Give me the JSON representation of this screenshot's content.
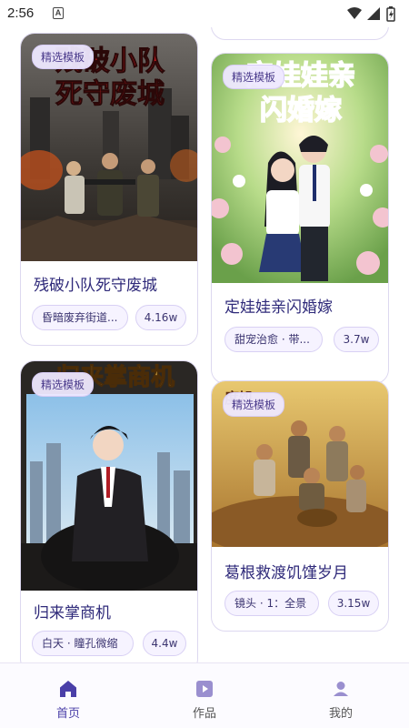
{
  "status_bar": {
    "time": "2:56",
    "notification_icon": "a-letter-icon",
    "icons": [
      "wifi-icon",
      "signal-icon",
      "battery-icon"
    ]
  },
  "colors": {
    "accent": "#4a3fa8",
    "badge_bg": "#eee8ff",
    "tag_bg": "#f6f3ff",
    "card_border": "#ddd8f0"
  },
  "feed": {
    "cards": [
      {
        "badge": "精选模板",
        "title": "残破小队死守废城",
        "cover_text": "残破小队\n死守废城",
        "tag": "昏暗废弃街道...",
        "count": "4.16w"
      },
      {
        "badge": "精选模板",
        "title": "定娃娃亲闪婚嫁",
        "cover_text": "定娃娃亲\n闪婚嫁",
        "tag": "甜宠治愈 · 带...",
        "count": "3.7w"
      },
      {
        "badge": "精选模板",
        "title": "归来掌商机",
        "cover_text": "归来掌商机",
        "tag": "白天 · 瞳孔微缩",
        "count": "4.4w"
      },
      {
        "badge": "精选模板",
        "title": "葛根救渡饥馑岁月",
        "cover_text": "度饥",
        "tag": "镜头 · 1：全景",
        "count": "3.15w"
      }
    ]
  },
  "bottom_nav": {
    "items": [
      {
        "label": "首页",
        "icon": "home-icon",
        "active": true
      },
      {
        "label": "作品",
        "icon": "play-icon",
        "active": false
      },
      {
        "label": "我的",
        "icon": "person-icon",
        "active": false
      }
    ]
  }
}
